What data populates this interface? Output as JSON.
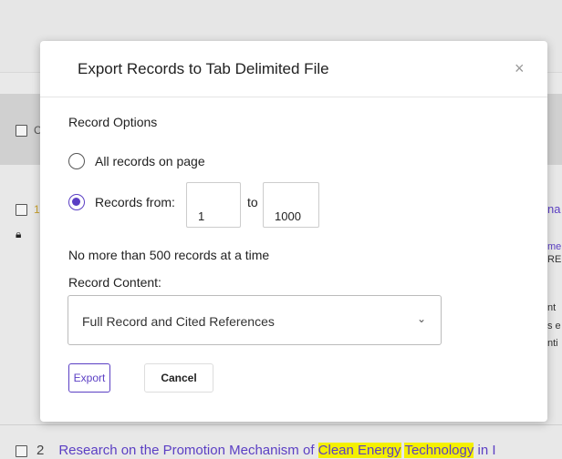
{
  "modal": {
    "title": "Export Records to Tab Delimited File",
    "close_glyph": "×",
    "record_options_label": "Record Options",
    "radio_all_label": "All records on page",
    "radio_range_label": "Records from:",
    "range_from_value": "1",
    "range_to_label": "to",
    "range_to_value": "1000",
    "limit_note": "No more than 500 records at a time",
    "record_content_label": "Record Content:",
    "record_content_selected": "Full Record and Cited References",
    "export_button": "Export",
    "cancel_button": "Cancel",
    "selected_option": "Records from:"
  },
  "background": {
    "row2_number": "2",
    "row2_title_prefix": "Research on the Promotion Mechanism of ",
    "row2_highlight1": "Clean Energy",
    "row2_highlight2": "Technology",
    "row2_title_suffix": " in I",
    "row1_number_fragment": "1",
    "toolbar_fragment": "C",
    "right_frag_1": "na",
    "right_frag_2": "me",
    "right_frag_3": "RE",
    "right_frag_4": "nt",
    "right_frag_5": "s e",
    "right_frag_6": "nti"
  },
  "colors": {
    "accent": "#5b3fc4",
    "highlight": "#f4f000"
  }
}
